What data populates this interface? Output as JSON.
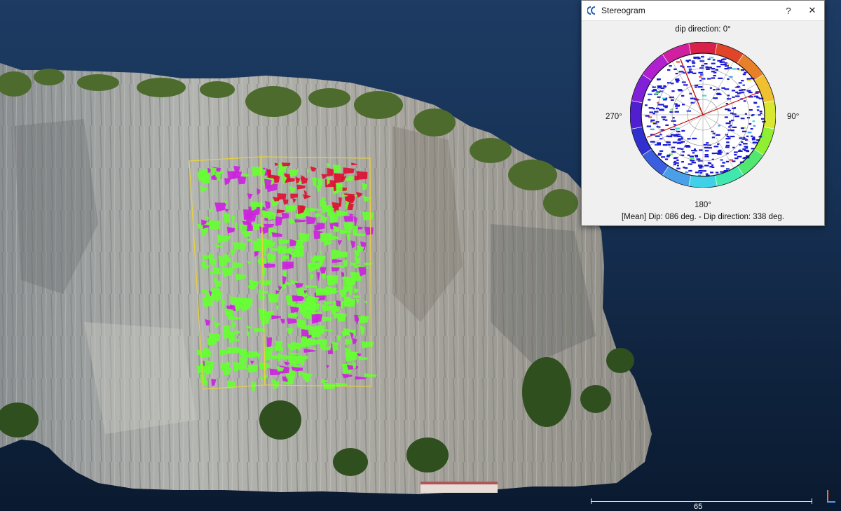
{
  "window": {
    "title": "Stereogram",
    "help_button": "?",
    "close_button": "✕"
  },
  "stereogram": {
    "north_label": "dip direction: 0°",
    "east_label": "90°",
    "south_label": "180°",
    "west_label": "270°",
    "mean_text": "[Mean] Dip: 086 deg. - Dip direction: 338 deg."
  },
  "scale": {
    "label": "65"
  },
  "colors": {
    "sky_top": "#1d3b63",
    "sky_bottom": "#0a1a30",
    "facet_green": "#66ff33",
    "facet_magenta": "#cc22dd",
    "facet_red": "#dd1133",
    "selection_box": "#e8d23a",
    "density_blue": "#1a1ad6",
    "mean_line": "#cc1111"
  }
}
